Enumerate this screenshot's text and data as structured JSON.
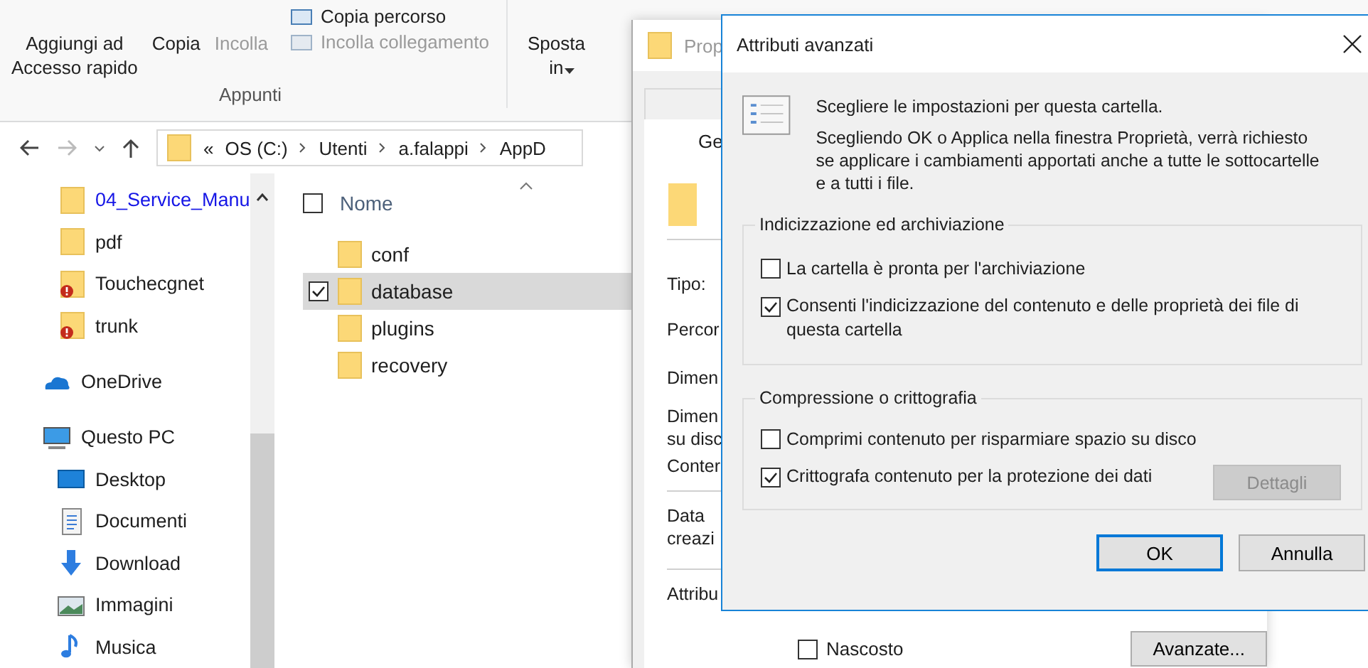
{
  "ribbon": {
    "large_buttons": [
      {
        "label": "Aggiungi ad\nAccesso rapido",
        "disabled": false
      },
      {
        "label": "Copia",
        "disabled": false
      },
      {
        "label": "Incolla",
        "disabled": true
      }
    ],
    "small_buttons": [
      {
        "label": "Copia percorso",
        "disabled": false
      },
      {
        "label": "Incolla collegamento",
        "disabled": true
      }
    ],
    "group_label": "Appunti",
    "move_button": {
      "label": "Sposta\nin"
    }
  },
  "address_bar": {
    "prefix": "«",
    "crumbs": [
      "OS (C:)",
      "Utenti",
      "a.falappi",
      "AppD"
    ]
  },
  "nav_pane": {
    "quick_access": [
      {
        "label": "04_Service_Manu",
        "compressed": true,
        "error": false
      },
      {
        "label": "pdf",
        "compressed": false,
        "error": false
      },
      {
        "label": "Touchecgnet",
        "compressed": false,
        "error": true
      },
      {
        "label": "trunk",
        "compressed": false,
        "error": true
      }
    ],
    "locations": [
      {
        "label": "OneDrive"
      },
      {
        "label": "Questo PC",
        "children": [
          {
            "label": "Desktop"
          },
          {
            "label": "Documenti"
          },
          {
            "label": "Download"
          },
          {
            "label": "Immagini"
          },
          {
            "label": "Musica"
          }
        ]
      }
    ]
  },
  "file_list": {
    "column": {
      "label": "Nome",
      "sorted": true
    },
    "select_all_checked": false,
    "rows": [
      {
        "name": "conf",
        "selected": false,
        "checked": false
      },
      {
        "name": "database",
        "selected": true,
        "checked": true
      },
      {
        "name": "plugins",
        "selected": false,
        "checked": false
      },
      {
        "name": "recovery",
        "selected": false,
        "checked": false
      }
    ]
  },
  "properties_window": {
    "title": "Prop",
    "tabs": [
      {
        "label": "Ge",
        "selected": true
      }
    ],
    "labels": [
      "Tipo:",
      "Percor",
      "Dimen",
      "Dimen\nsu disc",
      "Conter",
      "Data\ncreazi",
      "Attribu"
    ],
    "hidden_checkbox": {
      "label": "Nascosto",
      "checked": false
    },
    "advanced_button": "Avanzate..."
  },
  "advanced_dialog": {
    "title": "Attributi avanzati",
    "intro": "Scegliere le impostazioni per questa cartella.",
    "description": "Scegliendo OK o Applica nella finestra Proprietà, verrà richiesto\nse applicare i cambiamenti apportati anche a tutte le sottocartelle\ne a tutti i file.",
    "groups": [
      {
        "title": "Indicizzazione ed archiviazione",
        "options": [
          {
            "label": "La cartella è pronta per l'archiviazione",
            "checked": false
          },
          {
            "label": "Consenti l'indicizzazione del contenuto e delle proprietà dei file di questa cartella",
            "checked": true
          }
        ]
      },
      {
        "title": "Compressione o crittografia",
        "options": [
          {
            "label": "Comprimi contenuto per risparmiare spazio su disco",
            "checked": false
          },
          {
            "label": "Crittografa contenuto per la protezione dei dati",
            "checked": true
          }
        ],
        "button": {
          "label": "Dettagli",
          "disabled": true
        }
      }
    ],
    "buttons": [
      {
        "label": "OK",
        "default": true
      },
      {
        "label": "Annulla",
        "default": false
      }
    ]
  }
}
